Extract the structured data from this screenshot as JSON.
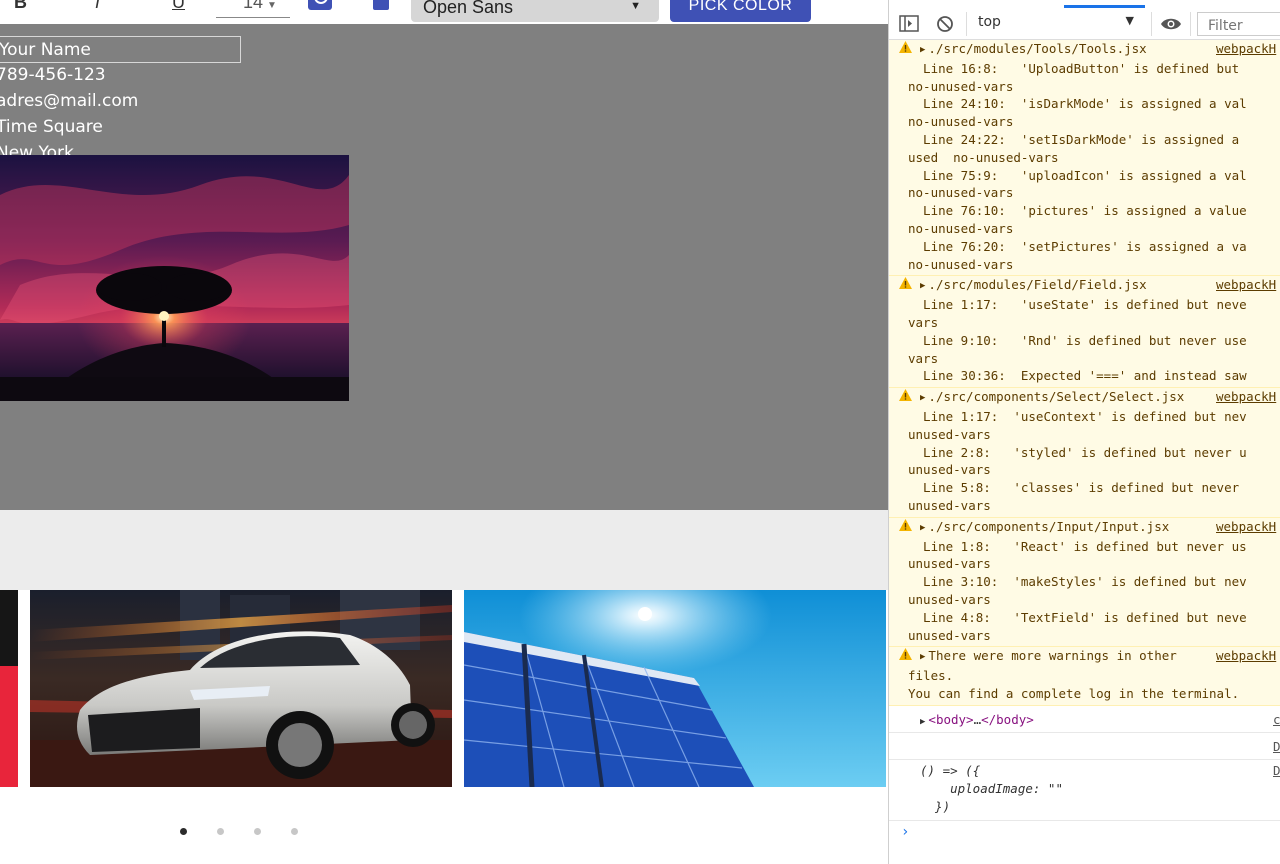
{
  "toolbar": {
    "bold_label": "B",
    "italic_label": "I",
    "underline_label": "U",
    "font_size": "14",
    "font_family": "Open Sans",
    "pick_color_label": "PICK COLOR",
    "accent_color": "#3f51b5"
  },
  "canvas": {
    "name_field": "Your Name",
    "phone": "789-456-123",
    "email": "adres@mail.com",
    "address": "Time Square",
    "city": "New York",
    "background": "#808080"
  },
  "carousel": {
    "slides": [
      "red-banner-image",
      "toyota-car-image",
      "solar-panel-image"
    ],
    "dots": 4,
    "active_dot": 0
  },
  "devtools": {
    "context": "top",
    "filter_placeholder": "Filter",
    "warnings": [
      {
        "file": "./src/modules/Tools/Tools.jsx",
        "source": "webpackH",
        "lines": [
          "  Line 16:8:   'UploadButton' is defined but",
          "no-unused-vars",
          "  Line 24:10:  'isDarkMode' is assigned a val",
          "no-unused-vars",
          "  Line 24:22:  'setIsDarkMode' is assigned a",
          "used  no-unused-vars",
          "  Line 75:9:   'uploadIcon' is assigned a val",
          "no-unused-vars",
          "  Line 76:10:  'pictures' is assigned a value",
          "no-unused-vars",
          "  Line 76:20:  'setPictures' is assigned a va",
          "no-unused-vars"
        ]
      },
      {
        "file": "./src/modules/Field/Field.jsx",
        "source": "webpackH",
        "lines": [
          "  Line 1:17:   'useState' is defined but neve",
          "vars",
          "  Line 9:10:   'Rnd' is defined but never use",
          "vars",
          "  Line 30:36:  Expected '===' and instead saw"
        ]
      },
      {
        "file": "./src/components/Select/Select.jsx",
        "source": "webpackH",
        "lines": [
          "  Line 1:17:  'useContext' is defined but nev",
          "unused-vars",
          "  Line 2:8:   'styled' is defined but never u",
          "unused-vars",
          "  Line 5:8:   'classes' is defined but never",
          "unused-vars"
        ]
      },
      {
        "file": "./src/components/Input/Input.jsx",
        "source": "webpackH",
        "lines": [
          "  Line 1:8:   'React' is defined but never us",
          "unused-vars",
          "  Line 3:10:  'makeStyles' is defined but nev",
          "unused-vars",
          "  Line 4:8:   'TextField' is defined but neve",
          "unused-vars"
        ]
      },
      {
        "file": "There were more warnings in other",
        "source": "webpackH",
        "lines": [
          "files.",
          "You can find a complete log in the terminal."
        ]
      }
    ],
    "body_node_open": "<body>",
    "body_node_ellipsis": "…",
    "body_node_close": "</body>",
    "body_src": "c",
    "blank_src": "D",
    "func_src": "D",
    "func_lines": [
      "() => ({",
      "    uploadImage: \"\"",
      "  })"
    ]
  }
}
